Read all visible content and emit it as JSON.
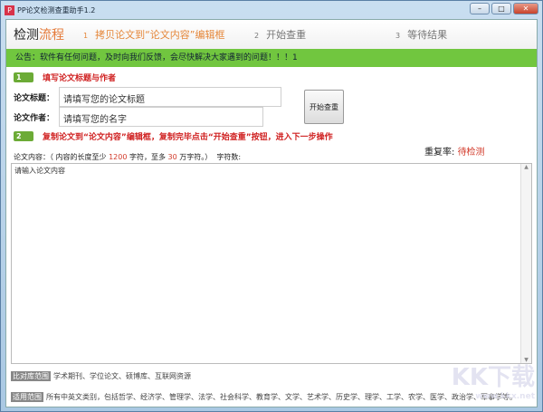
{
  "window": {
    "title": "PP论文检测查重助手1.2",
    "minimize": "–",
    "maximize": "□",
    "close": "✕",
    "icon_letter": "P"
  },
  "steps": {
    "brand_a": "检测",
    "brand_b": "流程",
    "items": [
      {
        "n": "1",
        "label": "拷贝论文到“论文内容”编辑框"
      },
      {
        "n": "2",
        "label": "开始查重"
      },
      {
        "n": "3",
        "label": "等待结果"
      }
    ]
  },
  "notice": "公告：软件有任何问题，及时向我们反馈，会尽快解决大家遇到的问题！！！1",
  "section1": {
    "num": "1",
    "label": "填写论文标题与作者"
  },
  "form": {
    "title_label": "论文标题：",
    "title_placeholder": "请填写您的论文标题",
    "author_label": "论文作者：",
    "author_placeholder": "请填写您的名字",
    "start_button": "开始查重"
  },
  "section2": {
    "num": "2",
    "label": "复制论文到“论文内容”编辑框，复制完毕点击“开始查重”按钮，进入下一步操作"
  },
  "content": {
    "label_a": "论文内容：（ 内容的长度至少 ",
    "min": "1200",
    "label_b": " 字符，至多 ",
    "max": "30",
    "label_c": " 万字符。）",
    "char_count_label": "字符数:",
    "rate_label": "重复率:",
    "rate_value": "待检测",
    "placeholder": "请输入论文内容"
  },
  "footer": {
    "db_badge": "比对库范围",
    "db_text": "学术期刊、学位论文、硕博库、互联网资源",
    "scope_badge": "适用范围",
    "scope_text": "所有中英文类别，包括哲学、经济学、管理学、法学、社会科学、教育学、文学、艺术学、历史学、理学、工学、农学、医学、政治学、军事学等。"
  },
  "watermark": {
    "logo": "KK下载",
    "url": "www.kkx.net"
  }
}
